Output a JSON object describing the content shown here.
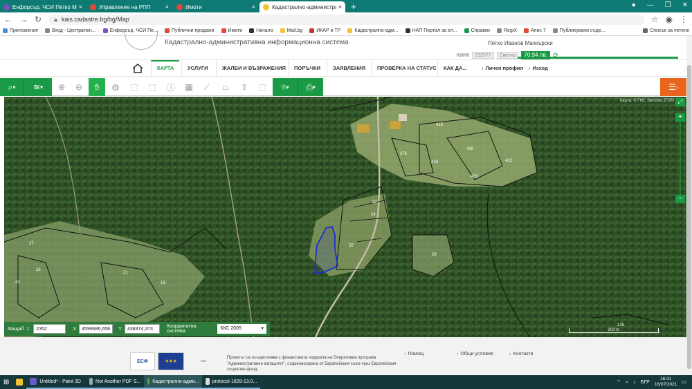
{
  "browser": {
    "tabs": [
      {
        "title": "Енфорсър, ЧСИ Петко Мачкър...",
        "color": "#7d4fc4"
      },
      {
        "title": "Управление на РПП",
        "color": "#e0493b"
      },
      {
        "title": "Имоти",
        "color": "#e0493b"
      },
      {
        "title": "Кадастрално-административна...",
        "color": "#f2c230"
      }
    ],
    "active_tab_index": 3,
    "url": "kais.cadastre.bg/bg/Map",
    "bookmarks": [
      "Приложения",
      "Вход - Централен...",
      "Енфорсър, ЧСИ Пе...",
      "Публични продажи",
      "Имоти",
      "Начало",
      "Mail.bg",
      "ИКАР и ТР",
      "Кадастрално-адм...",
      "НАП Портал за ел...",
      "Справки",
      "RegiX",
      "Апис 7",
      "Публикувани съде..."
    ],
    "reading_list": "Списък за четене"
  },
  "header": {
    "system_name": "Кадастрално-административна информационна система",
    "user_name": "Петко Иванов Мачкърски",
    "kiik_label": "КИИК",
    "kiik_value": "232577",
    "balance_label": "Сметка",
    "balance": "70,94 лв."
  },
  "menu": {
    "items": [
      "КАРТА",
      "УСЛУГИ",
      "ЖАЛБИ И ВЪЗРАЖЕНИЯ",
      "ПОРЪЧКИ",
      "ЗАЯВЛЕНИЯ",
      "ПРОВЕРКА НА СТАТУС",
      "КАК ДА..."
    ],
    "profile": "Личен профил",
    "logout": "Изход"
  },
  "map": {
    "parcels": [
      "416",
      "419",
      "422",
      "276",
      "418",
      "423",
      "32",
      "24",
      "55",
      "27",
      "26",
      "21",
      "19",
      "43",
      "29",
      "225"
    ],
    "attribution": "Карта: © ГКК, Sentinel, ESRI",
    "scale_text": "200 m"
  },
  "coords": {
    "scale_label": "Мащаб",
    "scale_prefix": "1:",
    "scale": "2352",
    "x_label": "X",
    "x": "4599686,658",
    "y_label": "Y",
    "y": "438374,373",
    "system_label": "Координатна система",
    "system": "ККС 2005"
  },
  "footer": {
    "text": "Проектът се осъществява с финансовата подкрепа на Оперативна програма \"Административен капацитет\", съфинансирана от Европейския съюз чрез Европейския социален фонд.",
    "links": [
      "Помощ",
      "Общи условия",
      "Контакти"
    ]
  },
  "taskbar": {
    "apps": [
      "Untitled* - Paint 3D",
      "Not Another PDF S...",
      "Кадастрално-адми...",
      "protocol-1828-13.0..."
    ],
    "time": "16:31",
    "date": "16/07/2021",
    "lang": "БГР"
  }
}
